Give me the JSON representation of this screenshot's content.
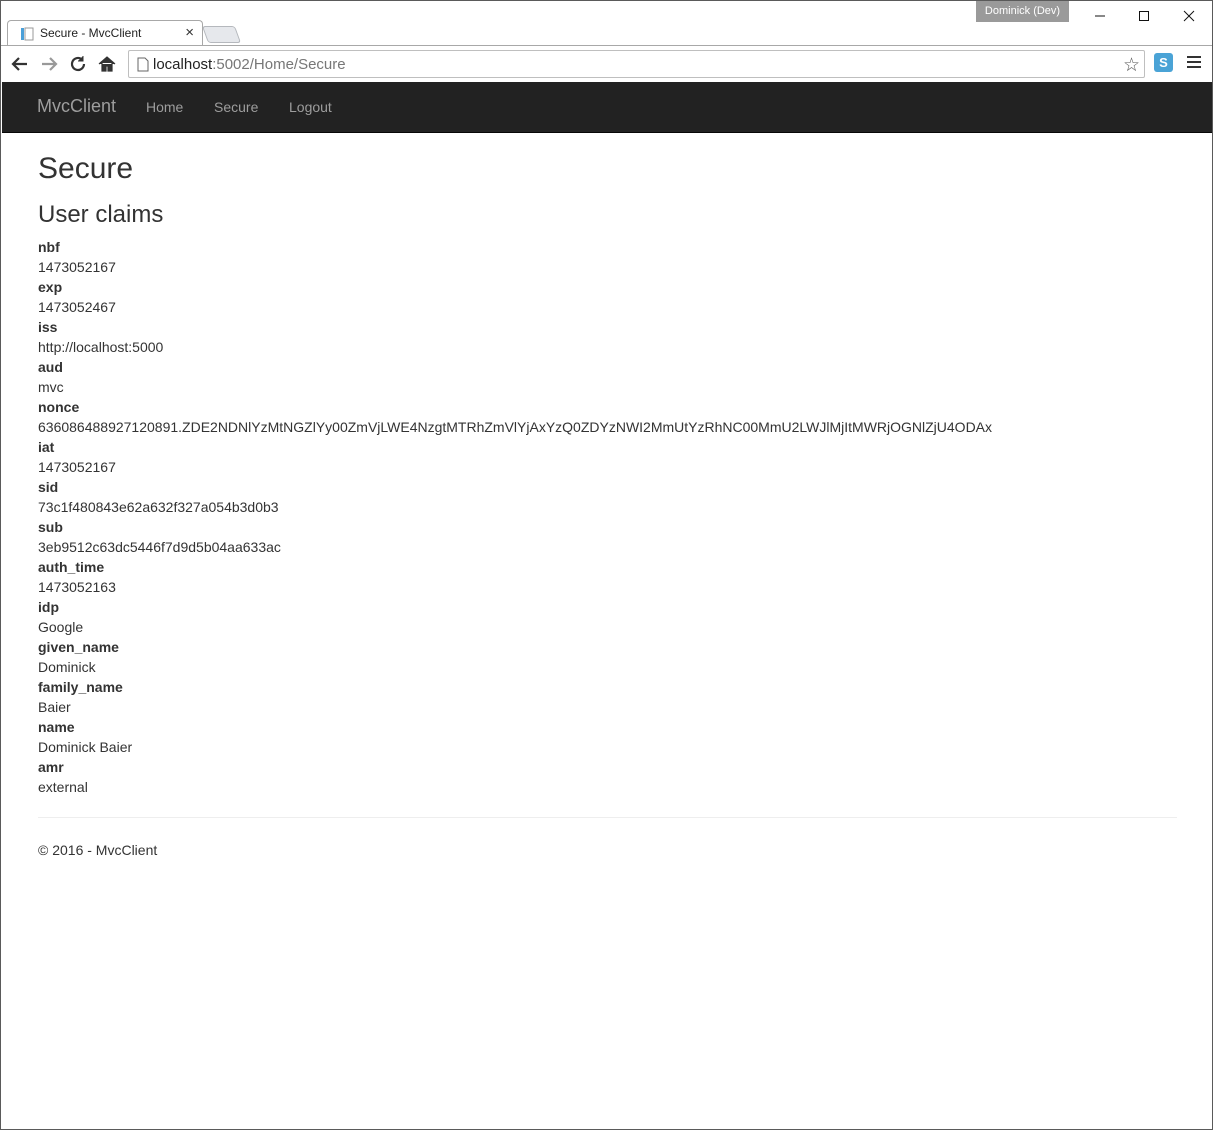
{
  "browser": {
    "tab_title": "Secure - MvcClient",
    "tab_close": "×",
    "profile_name": "Dominick (Dev)",
    "url_host": "localhost",
    "url_rest": ":5002/Home/Secure",
    "star": "☆",
    "extension_label": "S"
  },
  "navbar": {
    "brand": "MvcClient",
    "links": [
      "Home",
      "Secure",
      "Logout"
    ]
  },
  "page": {
    "title": "Secure",
    "subtitle": "User claims"
  },
  "claims": [
    {
      "type": "nbf",
      "value": "1473052167"
    },
    {
      "type": "exp",
      "value": "1473052467"
    },
    {
      "type": "iss",
      "value": "http://localhost:5000"
    },
    {
      "type": "aud",
      "value": "mvc"
    },
    {
      "type": "nonce",
      "value": "636086488927120891.ZDE2NDNlYzMtNGZlYy00ZmVjLWE4NzgtMTRhZmVlYjAxYzQ0ZDYzNWI2MmUtYzRhNC00MmU2LWJlMjItMWRjOGNlZjU4ODAx"
    },
    {
      "type": "iat",
      "value": "1473052167"
    },
    {
      "type": "sid",
      "value": "73c1f480843e62a632f327a054b3d0b3"
    },
    {
      "type": "sub",
      "value": "3eb9512c63dc5446f7d9d5b04aa633ac"
    },
    {
      "type": "auth_time",
      "value": "1473052163"
    },
    {
      "type": "idp",
      "value": "Google"
    },
    {
      "type": "given_name",
      "value": "Dominick"
    },
    {
      "type": "family_name",
      "value": "Baier"
    },
    {
      "type": "name",
      "value": "Dominick Baier"
    },
    {
      "type": "amr",
      "value": "external"
    }
  ],
  "footer": {
    "text": "© 2016 - MvcClient"
  }
}
